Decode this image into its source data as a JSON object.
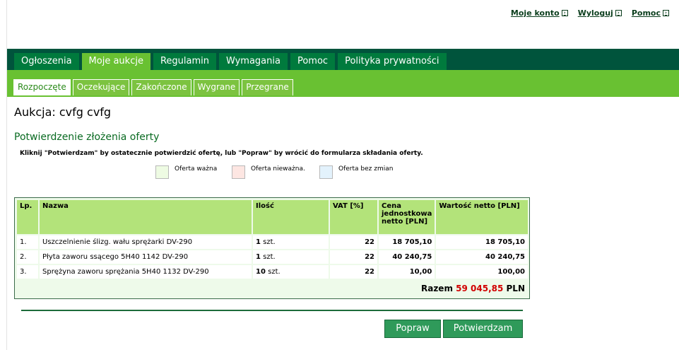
{
  "top_links": [
    "Moje konto",
    "Wyloguj",
    "Pomoc"
  ],
  "main_tabs": [
    {
      "label": "Ogłoszenia"
    },
    {
      "label": "Moje aukcje",
      "active": true
    },
    {
      "label": "Regulamin"
    },
    {
      "label": "Wymagania"
    },
    {
      "label": "Pomoc"
    },
    {
      "label": "Polityka prywatności"
    }
  ],
  "sub_tabs": [
    {
      "label": "Rozpoczęte",
      "active": true
    },
    {
      "label": "Oczekujące"
    },
    {
      "label": "Zakończone"
    },
    {
      "label": "Wygrane"
    },
    {
      "label": "Przegrane"
    }
  ],
  "page_title": "Aukcja: cvfg cvfg",
  "section_title": "Potwierdzenie złożenia oferty",
  "instructions": "Kliknij \"Potwierdzam\" by ostatecznie potwierdzić ofertę, lub \"Popraw\" by wrócić do formularza składania oferty.",
  "legend": [
    {
      "label": "Oferta ważna",
      "color": "#eefbe3"
    },
    {
      "label": "Oferta nieważna.",
      "color": "#fde6e2"
    },
    {
      "label": "Oferta bez zmian",
      "color": "#e3f2fc"
    }
  ],
  "table": {
    "headers": [
      "Lp.",
      "Nazwa",
      "Ilość",
      "VAT [%]",
      "Cena jednostkowa netto [PLN]",
      "Wartość netto [PLN]"
    ],
    "rows": [
      {
        "lp": "1.",
        "name": "Uszczelnienie ślizg. wału sprężarki DV-290",
        "qty": "1",
        "unit": "szt.",
        "vat": "22",
        "price": "18 705,10",
        "value": "18 705,10"
      },
      {
        "lp": "2.",
        "name": "Płyta zaworu ssącego 5H40 1142 DV-290",
        "qty": "1",
        "unit": "szt.",
        "vat": "22",
        "price": "40 240,75",
        "value": "40 240,75"
      },
      {
        "lp": "3.",
        "name": "Sprężyna zaworu sprężania 5H40 1132 DV-290",
        "qty": "10",
        "unit": "szt.",
        "vat": "22",
        "price": "10,00",
        "value": "100,00"
      }
    ],
    "total_label": "Razem",
    "total_value": "59 045,85",
    "total_currency": "PLN"
  },
  "buttons": {
    "fix": "Popraw",
    "confirm": "Potwierdzam"
  }
}
